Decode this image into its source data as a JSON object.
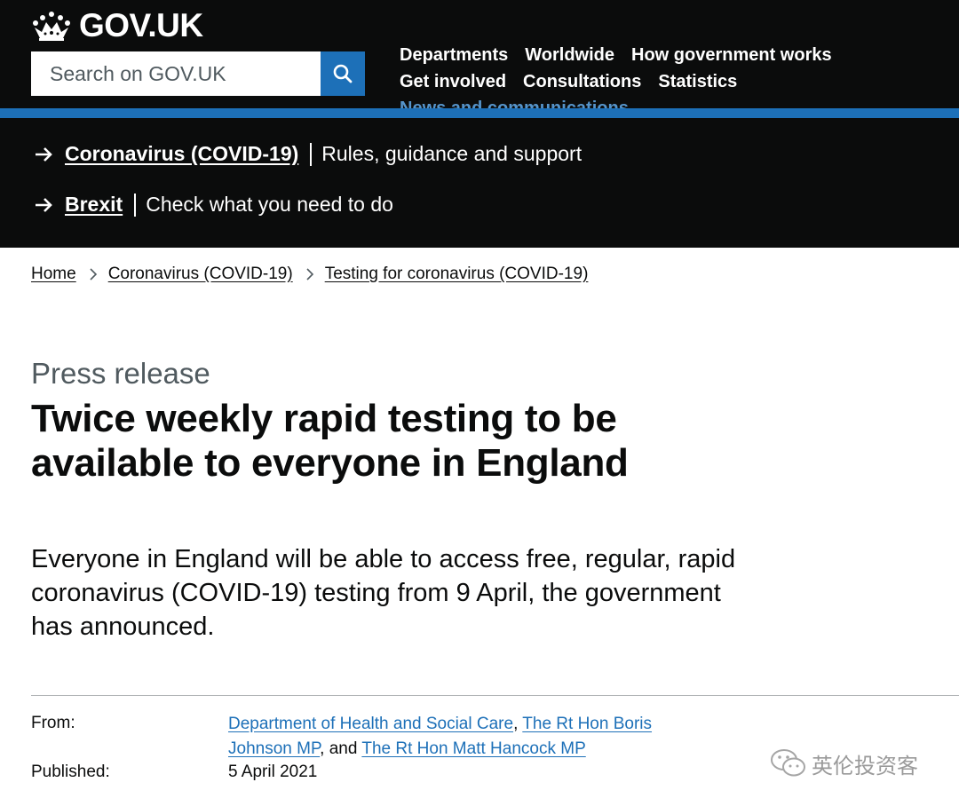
{
  "header": {
    "logo_text": "GOV.UK",
    "search_placeholder": "Search on GOV.UK",
    "nav": [
      {
        "label": "Departments"
      },
      {
        "label": "Worldwide"
      },
      {
        "label": "How government works"
      },
      {
        "label": "Get involved"
      },
      {
        "label": "Consultations"
      },
      {
        "label": "Statistics"
      },
      {
        "label": "News and communications"
      }
    ],
    "active_nav_color": "#5694ca",
    "accent_color": "#1d70b8"
  },
  "banner": {
    "items": [
      {
        "link": "Coronavirus (COVID-19)",
        "text": "Rules, guidance and support"
      },
      {
        "link": "Brexit",
        "text": "Check what you need to do"
      }
    ]
  },
  "breadcrumb": [
    {
      "label": "Home"
    },
    {
      "label": "Coronavirus (COVID-19)"
    },
    {
      "label": "Testing for coronavirus (COVID-19)"
    }
  ],
  "article": {
    "caption": "Press release",
    "title": "Twice weekly rapid testing to be available to everyone in England",
    "lead": "Everyone in England will be able to access free, regular, rapid coronavirus (COVID-19) testing from 9 April, the government has announced."
  },
  "metadata": {
    "from_label": "From:",
    "from_links": [
      "Department of Health and Social Care",
      "The Rt Hon Boris Johnson MP",
      "The Rt Hon Matt Hancock MP"
    ],
    "from_sep1": ", ",
    "from_sep2": ", and ",
    "published_label": "Published:",
    "published_value": "5 April 2021"
  },
  "watermark": {
    "text": "英伦投资客",
    "icon": "wechat-icon"
  }
}
